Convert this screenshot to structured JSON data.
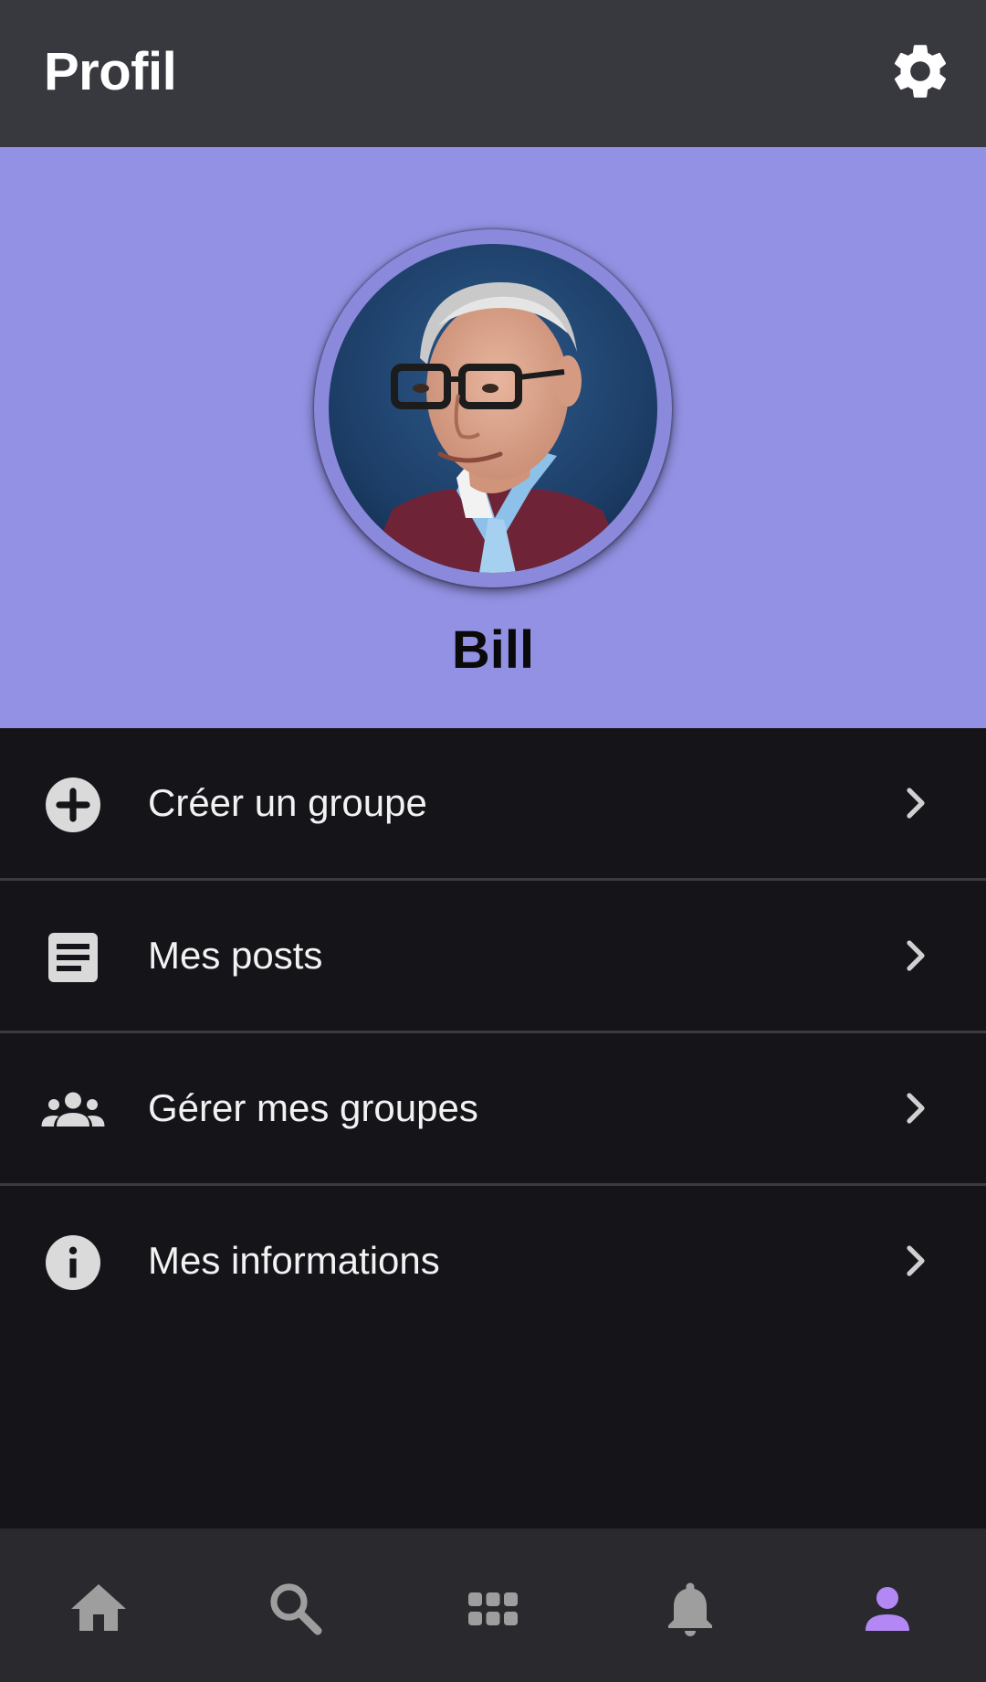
{
  "app_bar": {
    "title": "Profil",
    "settings_icon": "gear-icon"
  },
  "profile": {
    "name": "Bill",
    "avatar": "profile-photo",
    "header_color": "#9291e3"
  },
  "menu": {
    "items": [
      {
        "label": "Créer un groupe",
        "icon": "add-circle-icon"
      },
      {
        "label": "Mes posts",
        "icon": "article-icon"
      },
      {
        "label": "Gérer mes groupes",
        "icon": "groups-icon"
      },
      {
        "label": "Mes informations",
        "icon": "info-icon"
      }
    ],
    "chevron_icon": "chevron-right-icon"
  },
  "bottom_nav": {
    "items": [
      {
        "icon": "home-icon",
        "active": false
      },
      {
        "icon": "search-icon",
        "active": false
      },
      {
        "icon": "apps-grid-icon",
        "active": false
      },
      {
        "icon": "bell-icon",
        "active": false
      },
      {
        "icon": "person-icon",
        "active": true
      }
    ],
    "active_color": "#b388f5",
    "inactive_color": "#9e9e9e"
  }
}
